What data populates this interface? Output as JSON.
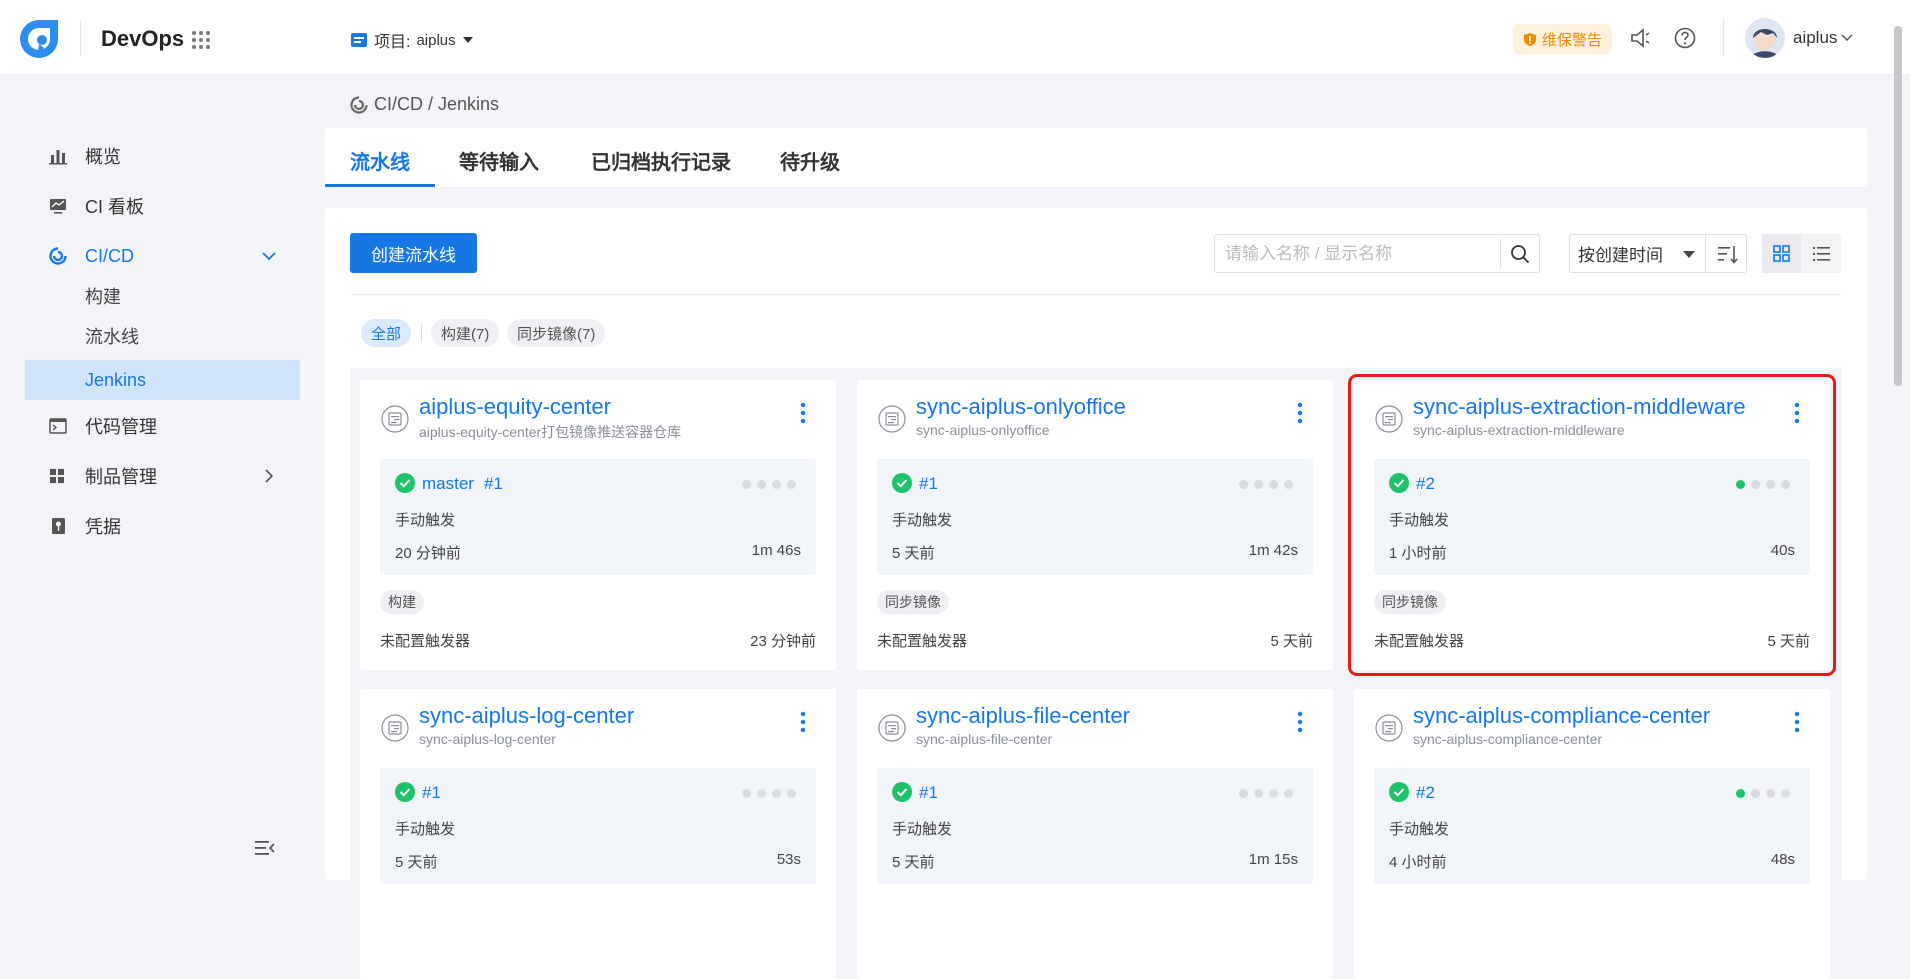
{
  "header": {
    "brand": "DevOps",
    "project_label": "项目:",
    "project_value": "aiplus",
    "warning_badge": "维保警告",
    "username": "aiplus"
  },
  "sidebar": {
    "items": [
      {
        "label": "概览"
      },
      {
        "label": "CI 看板"
      },
      {
        "label": "CI/CD"
      },
      {
        "label": "代码管理"
      },
      {
        "label": "制品管理"
      },
      {
        "label": "凭据"
      }
    ],
    "sub_items": [
      {
        "label": "构建"
      },
      {
        "label": "流水线"
      },
      {
        "label": "Jenkins"
      }
    ]
  },
  "breadcrumb": "CI/CD / Jenkins",
  "tabs": [
    {
      "label": "流水线"
    },
    {
      "label": "等待输入"
    },
    {
      "label": "已归档执行记录"
    },
    {
      "label": "待升级"
    }
  ],
  "toolbar": {
    "create_label": "创建流水线",
    "search_placeholder": "请输入名称 / 显示名称",
    "sort_label": "按创建时间"
  },
  "filters": [
    {
      "label": "全部"
    },
    {
      "label": "构建(7)"
    },
    {
      "label": "同步镜像(7)"
    }
  ],
  "cards": [
    {
      "name": "aiplus-equity-center",
      "desc": "aiplus-equity-center打包镜像推送容器仓库",
      "branch": "master",
      "run": "#1",
      "trigger": "手动触发",
      "ago": "20 分钟前",
      "duration": "1m 46s",
      "tag": "构建",
      "trigger_config": "未配置触发器",
      "updated": "23 分钟前",
      "active_dots": 0
    },
    {
      "name": "sync-aiplus-onlyoffice",
      "desc": "sync-aiplus-onlyoffice",
      "branch": "",
      "run": "#1",
      "trigger": "手动触发",
      "ago": "5 天前",
      "duration": "1m 42s",
      "tag": "同步镜像",
      "trigger_config": "未配置触发器",
      "updated": "5 天前",
      "active_dots": 0
    },
    {
      "name": "sync-aiplus-extraction-middleware",
      "desc": "sync-aiplus-extraction-middleware",
      "branch": "",
      "run": "#2",
      "trigger": "手动触发",
      "ago": "1 小时前",
      "duration": "40s",
      "tag": "同步镜像",
      "trigger_config": "未配置触发器",
      "updated": "5 天前",
      "active_dots": 1
    },
    {
      "name": "sync-aiplus-log-center",
      "desc": "sync-aiplus-log-center",
      "branch": "",
      "run": "#1",
      "trigger": "手动触发",
      "ago": "5 天前",
      "duration": "53s",
      "tag": "",
      "trigger_config": "",
      "updated": "",
      "active_dots": 0
    },
    {
      "name": "sync-aiplus-file-center",
      "desc": "sync-aiplus-file-center",
      "branch": "",
      "run": "#1",
      "trigger": "手动触发",
      "ago": "5 天前",
      "duration": "1m 15s",
      "tag": "",
      "trigger_config": "",
      "updated": "",
      "active_dots": 0
    },
    {
      "name": "sync-aiplus-compliance-center",
      "desc": "sync-aiplus-compliance-center",
      "branch": "",
      "run": "#2",
      "trigger": "手动触发",
      "ago": "4 小时前",
      "duration": "48s",
      "tag": "",
      "trigger_config": "",
      "updated": "",
      "active_dots": 1
    }
  ],
  "colors": {
    "accent": "#1677e5",
    "success": "#1ec26a",
    "highlight": "#e41d1d",
    "warning": "#f08c00"
  }
}
